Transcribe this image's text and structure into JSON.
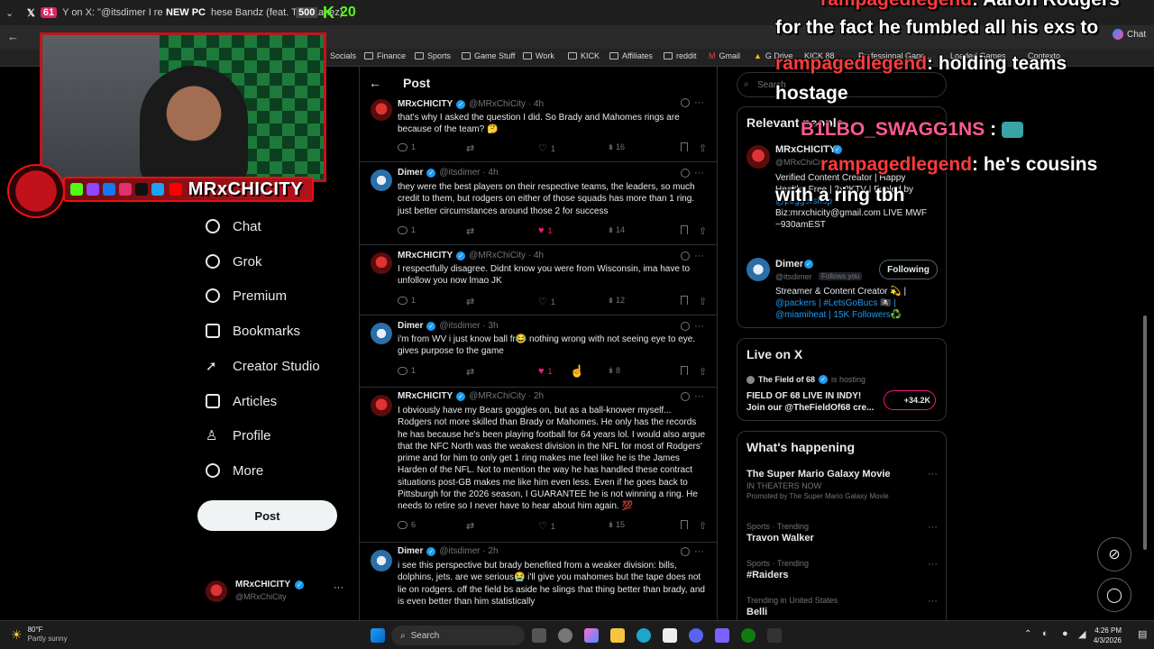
{
  "browser": {
    "tabs": [
      {
        "label": "61",
        "text": "Y on X: \"@itsdimer I re"
      },
      {
        "label": "NEW PC",
        "text": "hese Bandz (feat. Tory Lanez)"
      },
      {
        "label": "500",
        "text": ""
      },
      {
        "label": "20",
        "text": ""
      }
    ],
    "bookmarks": [
      "Socials",
      "Finance",
      "Sports",
      "Game Stuff",
      "Work",
      "KICK",
      "Affiliates",
      "reddit",
      "Gmail",
      "G Drive",
      "KICK 88",
      "Professional Gapp...",
      "Loaded Games",
      "Contexto"
    ],
    "chat_label": "Chat"
  },
  "stream": {
    "streamer_name": "MRxCHICITY"
  },
  "nav": {
    "items": [
      "Chat",
      "Grok",
      "Premium",
      "Bookmarks",
      "Creator Studio",
      "Articles",
      "Profile",
      "More"
    ],
    "post_button": "Post",
    "account_name": "MRxCHICITY",
    "account_handle": "@MRxChiCity",
    "account_more": "···"
  },
  "main": {
    "back_icon": "←",
    "title": "Post",
    "tweets": [
      {
        "name": "MRxCHICITY",
        "handle": "@MRxChiCity · 4h",
        "text": "that's why I asked the question I did. So Brady and Mahomes rings are because of the team? 🤔",
        "reply": "1",
        "repost": "",
        "like": "1",
        "views": "16",
        "liked": false
      },
      {
        "name": "Dimer",
        "handle": "@itsdimer · 4h",
        "text": "they were the best players on their respective teams, the leaders, so much credit to them, but rodgers on either of those squads has more than 1 ring. just better circumstances around those 2 for success",
        "reply": "1",
        "repost": "",
        "like": "1",
        "views": "14",
        "liked": true
      },
      {
        "name": "MRxCHICITY",
        "handle": "@MRxChiCity · 4h",
        "text": "I respectfully disagree. Didnt know you were from Wisconsin, ima have to unfollow you now lmao JK",
        "reply": "1",
        "repost": "",
        "like": "1",
        "views": "12",
        "liked": false
      },
      {
        "name": "Dimer",
        "handle": "@itsdimer · 3h",
        "text": "i'm from WV i just know ball fr😂 nothing wrong with not seeing eye to eye. gives purpose to the game",
        "reply": "1",
        "repost": "",
        "like": "1",
        "views": "8",
        "liked": true
      },
      {
        "name": "MRxCHICITY",
        "handle": "@MRxChiCity · 2h",
        "text": "I obviously have my Bears goggles on, but as a ball-knower myself... Rodgers not more skilled than Brady or Mahomes. He only has the records he has because he's been playing football for 64 years lol. I would also argue that the NFC North was the weakest division in the NFL for most of Rodgers' prime and for him to only get 1 ring makes me feel like he is the James Harden of the NFL. Not to mention the way he has handled these contract situations post-GB makes me like him even less. Even if he goes back to Pittsburgh for the 2026 season, I GUARANTEE he is not winning a ring. He needs to retire so I never have to hear about him again. 💯",
        "reply": "6",
        "repost": "",
        "like": "1",
        "views": "15",
        "liked": false
      },
      {
        "name": "Dimer",
        "handle": "@itsdimer · 2h",
        "text": "i see this perspective but brady benefited from a weaker division: bills, dolphins, jets. are we serious😭 i'll give you mahomes but the tape does not lie on rodgers. off the field bs aside he slings that thing better than brady, and is even better than him statistically",
        "reply": "",
        "repost": "",
        "like": "",
        "views": "",
        "liked": false
      }
    ]
  },
  "right": {
    "search_placeholder": "Search",
    "relevant_title": "Relevant people",
    "person1": {
      "name": "MRxCHICITY",
      "handle": "@MRxChiCity",
      "bio1": "Verified Content Creator | Happy",
      "bio2": "Healthy Free | 2x?KTV | Fueled by",
      "bio3": "@poggershop",
      "bio4": "Biz:mrxchicity@gmail.com LIVE MWF",
      "bio5": "~930amEST"
    },
    "person2": {
      "name": "Dimer",
      "handle": "@itsdimer",
      "follows_you": "Follows you",
      "button": "Following",
      "bio1": "Streamer & Content Creator 💫 |",
      "bio2": "@packers | #LetsGoBucs 🏴‍☠️ |",
      "bio3": "@miamiheat | 15K Followers♻️"
    },
    "live_title": "Live on X",
    "live_host": "The Field of 68",
    "live_hosting": "is hosting",
    "live_event": "FIELD OF 68 LIVE IN INDY!",
    "live_desc": "Join our @TheFieldOf68 cre...",
    "live_count": "+34.2K",
    "happening_title": "What's happening",
    "trends": [
      {
        "cat": "",
        "title": "The Super Mario Galaxy Movie",
        "sub": "IN THEATERS NOW",
        "promo": "Promoted by The Super Mario Galaxy Movie"
      },
      {
        "cat": "Sports · Trending",
        "title": "Travon Walker"
      },
      {
        "cat": "Sports · Trending",
        "title": "#Raiders"
      },
      {
        "cat": "Trending in United States",
        "title": "Belli"
      }
    ]
  },
  "overlay": [
    {
      "user": "rampagedlegend",
      "msg": ": Aaron Rodgers"
    },
    {
      "user": "",
      "msg": "for the fact he fumbled all his exs to"
    },
    {
      "user": "rampagedlegend",
      "msg": ": holding teams"
    },
    {
      "user": "",
      "msg": "hostage"
    },
    {
      "user": "B1LBO_SWAGG1NS",
      "msg": ":"
    },
    {
      "user": "rampagedlegend",
      "msg": ": he's cousins"
    },
    {
      "user": "",
      "msg": "with a ring tbh"
    }
  ],
  "taskbar": {
    "weather_temp": "80°F",
    "weather_desc": "Partly sunny",
    "search": "Search",
    "time": "4:26 PM",
    "date": "4/3/2026"
  },
  "colors": {
    "accent": "#1d9bf0",
    "like": "#f91880",
    "stream_red": "#c0141b"
  }
}
